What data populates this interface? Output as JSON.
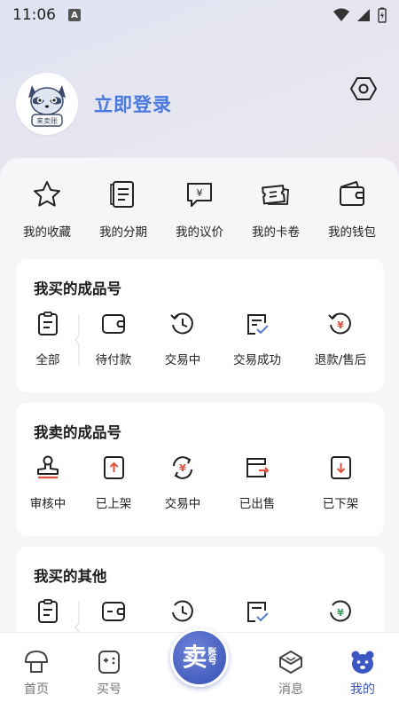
{
  "status_bar": {
    "time": "11:06",
    "a_badge": "A"
  },
  "profile": {
    "login_text": "立即登录",
    "avatar_caption": "来卖账"
  },
  "quick_actions": [
    {
      "label": "我的收藏",
      "icon": "star-icon"
    },
    {
      "label": "我的分期",
      "icon": "installment-icon"
    },
    {
      "label": "我的议价",
      "icon": "bargain-icon"
    },
    {
      "label": "我的卡卷",
      "icon": "coupon-icon"
    },
    {
      "label": "我的钱包",
      "icon": "wallet-icon"
    }
  ],
  "buy_card": {
    "title": "我买的成品号",
    "items": [
      {
        "label": "全部",
        "icon": "clipboard-icon"
      },
      {
        "label": "待付款",
        "icon": "wallet-pending-icon"
      },
      {
        "label": "交易中",
        "icon": "clock-icon"
      },
      {
        "label": "交易成功",
        "icon": "document-check-icon"
      },
      {
        "label": "退款/售后",
        "icon": "refund-icon"
      }
    ]
  },
  "sell_card": {
    "title": "我卖的成品号",
    "items": [
      {
        "label": "审核中",
        "icon": "stamp-icon"
      },
      {
        "label": "已上架",
        "icon": "arrow-up-box-icon"
      },
      {
        "label": "交易中",
        "icon": "exchange-icon"
      },
      {
        "label": "已出售",
        "icon": "box-sold-icon"
      },
      {
        "label": "已下架",
        "icon": "arrow-down-box-icon"
      }
    ]
  },
  "other_card": {
    "title": "我买的其他"
  },
  "center_button": {
    "big": "卖",
    "small_top": "账",
    "small_bottom": "号"
  },
  "tabbar": {
    "home": "首页",
    "buy": "买号",
    "messages": "消息",
    "mine": "我的"
  },
  "colors": {
    "accent": "#4a7ae0",
    "active_tab": "#3a57c4",
    "refund_accent": "#e0503a"
  }
}
